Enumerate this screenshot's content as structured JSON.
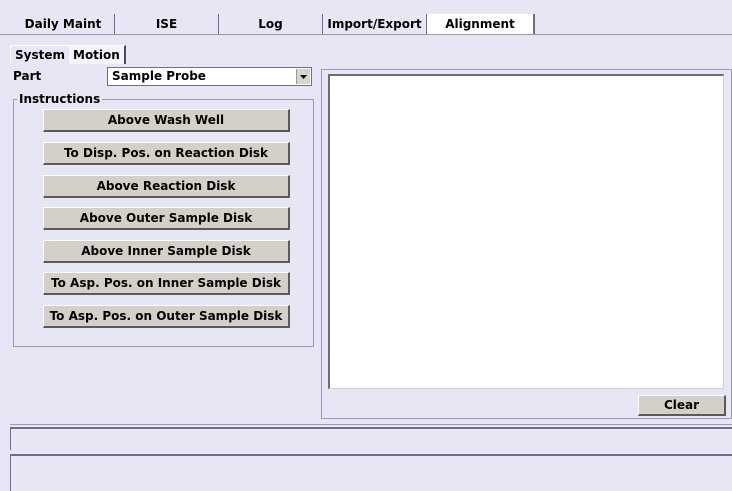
{
  "tabs": {
    "daily_maint": "Daily Maint",
    "ise": "ISE",
    "log": "Log",
    "import_export": "Import/Export",
    "alignment": "Alignment"
  },
  "subtabs": {
    "system": "System",
    "motion": "Motion"
  },
  "part": {
    "label": "Part",
    "value": "Sample Probe"
  },
  "instructions": {
    "title": "Instructions",
    "buttons": [
      "Above Wash Well",
      "To Disp. Pos. on Reaction Disk",
      "Above Reaction Disk",
      "Above Outer Sample Disk",
      "Above Inner Sample Disk",
      "To Asp. Pos. on Inner Sample Disk",
      "To Asp. Pos. on Outer Sample Disk"
    ]
  },
  "clear_label": "Clear"
}
